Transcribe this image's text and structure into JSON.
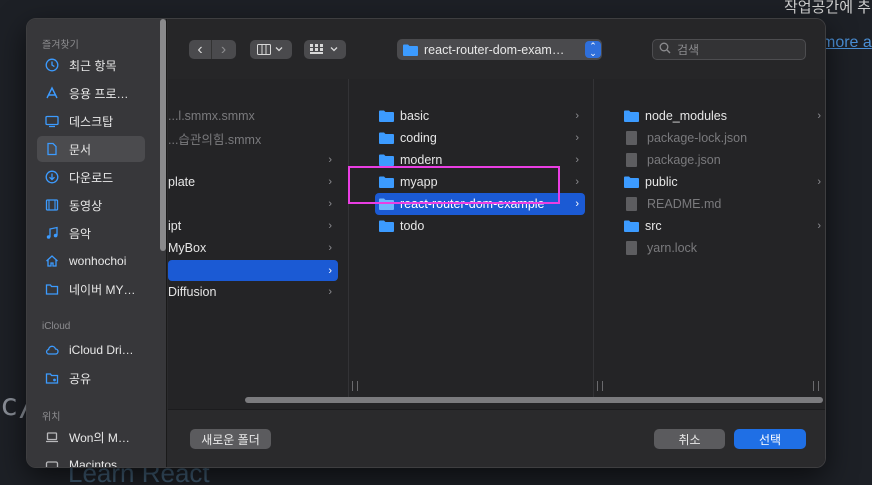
{
  "background": {
    "korean_text": "작업공간에 추",
    "more_link": "more a",
    "code_text": "c/",
    "learn_text": "Learn React"
  },
  "sidebar": {
    "sections": [
      "즐겨찾기",
      "iCloud",
      "위치"
    ],
    "favorites": [
      {
        "label": "최근 항목",
        "icon": "clock-icon"
      },
      {
        "label": "응용 프로…",
        "icon": "apps-icon"
      },
      {
        "label": "데스크탑",
        "icon": "desktop-icon"
      },
      {
        "label": "문서",
        "icon": "document-icon",
        "active": true
      },
      {
        "label": "다운로드",
        "icon": "download-icon"
      },
      {
        "label": "동영상",
        "icon": "film-icon"
      },
      {
        "label": "음악",
        "icon": "music-icon"
      },
      {
        "label": "wonhochoi",
        "icon": "home-icon"
      },
      {
        "label": "네이버 MY…",
        "icon": "folder-icon"
      }
    ],
    "icloud": [
      {
        "label": "iCloud Dri…",
        "icon": "cloud-icon"
      },
      {
        "label": "공유",
        "icon": "shared-folder-icon"
      }
    ],
    "locations": [
      {
        "label": "Won의 M…",
        "icon": "laptop-icon"
      },
      {
        "label": "Macintos…",
        "icon": "disk-icon"
      }
    ]
  },
  "toolbar": {
    "back_icon": "‹",
    "forward_icon": "›",
    "path_label": "react-router-dom-exam…",
    "search_placeholder": "검색"
  },
  "column1": [
    {
      "label": "...l.smmx.smmx",
      "dim": true
    },
    {
      "label": "...습관의힘.smmx",
      "dim": true
    },
    {
      "label": "",
      "chevron": true
    },
    {
      "label": "plate",
      "chevron": true
    },
    {
      "label": "",
      "chevron": true
    },
    {
      "label": "ipt",
      "chevron": true
    },
    {
      "label": "MyBox",
      "chevron": true
    },
    {
      "label": "",
      "chevron": true,
      "selected": true
    },
    {
      "label": "Diffusion",
      "chevron": true
    }
  ],
  "column2": [
    {
      "label": "basic"
    },
    {
      "label": "coding"
    },
    {
      "label": "modern"
    },
    {
      "label": "myapp"
    },
    {
      "label": "react-router-dom-example",
      "selected": true
    },
    {
      "label": "todo"
    }
  ],
  "column3": [
    {
      "label": "node_modules",
      "type": "folder",
      "chevron": true
    },
    {
      "label": "package-lock.json",
      "type": "file",
      "dim": true
    },
    {
      "label": "package.json",
      "type": "file",
      "dim": true
    },
    {
      "label": "public",
      "type": "folder",
      "chevron": true
    },
    {
      "label": "README.md",
      "type": "file",
      "dim": true
    },
    {
      "label": "src",
      "type": "folder",
      "chevron": true
    },
    {
      "label": "yarn.lock",
      "type": "file",
      "dim": true
    }
  ],
  "buttons": {
    "new_folder": "새로운 폴더",
    "cancel": "취소",
    "select": "선택"
  },
  "colors": {
    "accent": "#1f6fe5",
    "selection": "#1b5ad4",
    "highlight": "#ea3ee3",
    "folder": "#3c9bff"
  }
}
